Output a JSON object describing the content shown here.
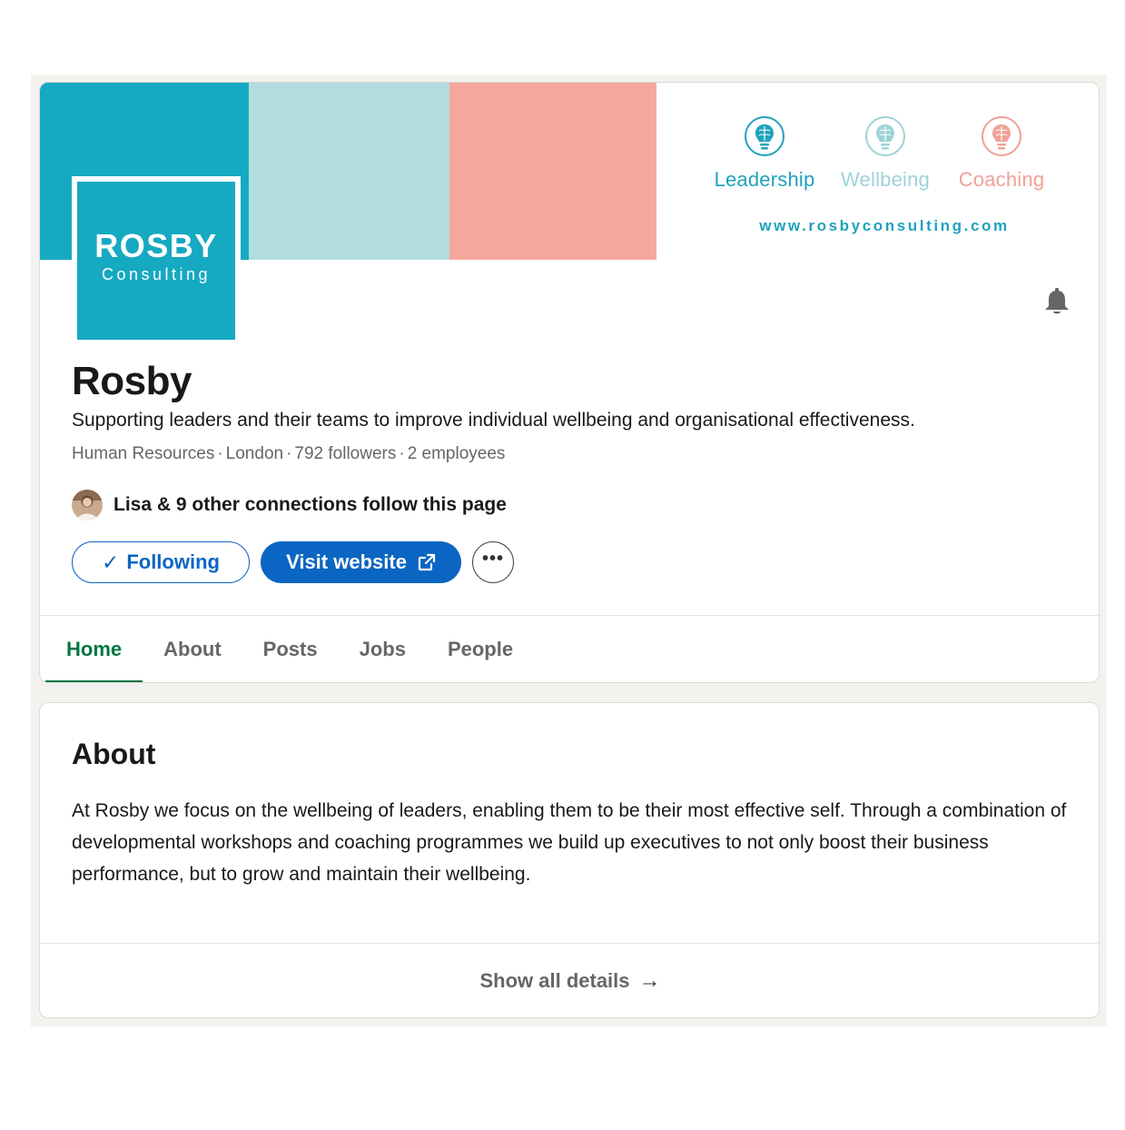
{
  "banner": {
    "colors": [
      "#16a9c2",
      "#b1dde0",
      "#f6a79d"
    ],
    "pillars": [
      {
        "label": "Leadership",
        "color": "#1fa2bd",
        "icon": "lightbulb-brain-icon"
      },
      {
        "label": "Wellbeing",
        "color": "#9dd3d7",
        "icon": "lightbulb-brain-icon"
      },
      {
        "label": "Coaching",
        "color": "#f0a197",
        "icon": "lightbulb-brain-icon"
      }
    ],
    "url": "www.rosbyconsulting.com",
    "url_color": "#1fa2bd"
  },
  "logo": {
    "word": "ROSBY",
    "sub": "Consulting",
    "color": "#16a9c2"
  },
  "company": {
    "name": "Rosby",
    "tagline": "Supporting leaders and their teams to improve individual wellbeing and organisational effectiveness.",
    "industry": "Human Resources",
    "location": "London",
    "followers": "792 followers",
    "employees": "2 employees"
  },
  "connections": {
    "text": "Lisa & 9 other connections follow this page"
  },
  "actions": {
    "following_label": "Following",
    "visit_label": "Visit website",
    "more_label": "•••"
  },
  "tabs": [
    {
      "label": "Home",
      "active": true
    },
    {
      "label": "About",
      "active": false
    },
    {
      "label": "Posts",
      "active": false
    },
    {
      "label": "Jobs",
      "active": false
    },
    {
      "label": "People",
      "active": false
    }
  ],
  "about": {
    "title": "About",
    "body": "At Rosby we focus on the wellbeing of leaders, enabling them to be their most effective self. Through a combination of developmental workshops and coaching programmes we build up executives to not only boost their business performance, but to grow and maintain their wellbeing.",
    "show_all": "Show all details"
  }
}
